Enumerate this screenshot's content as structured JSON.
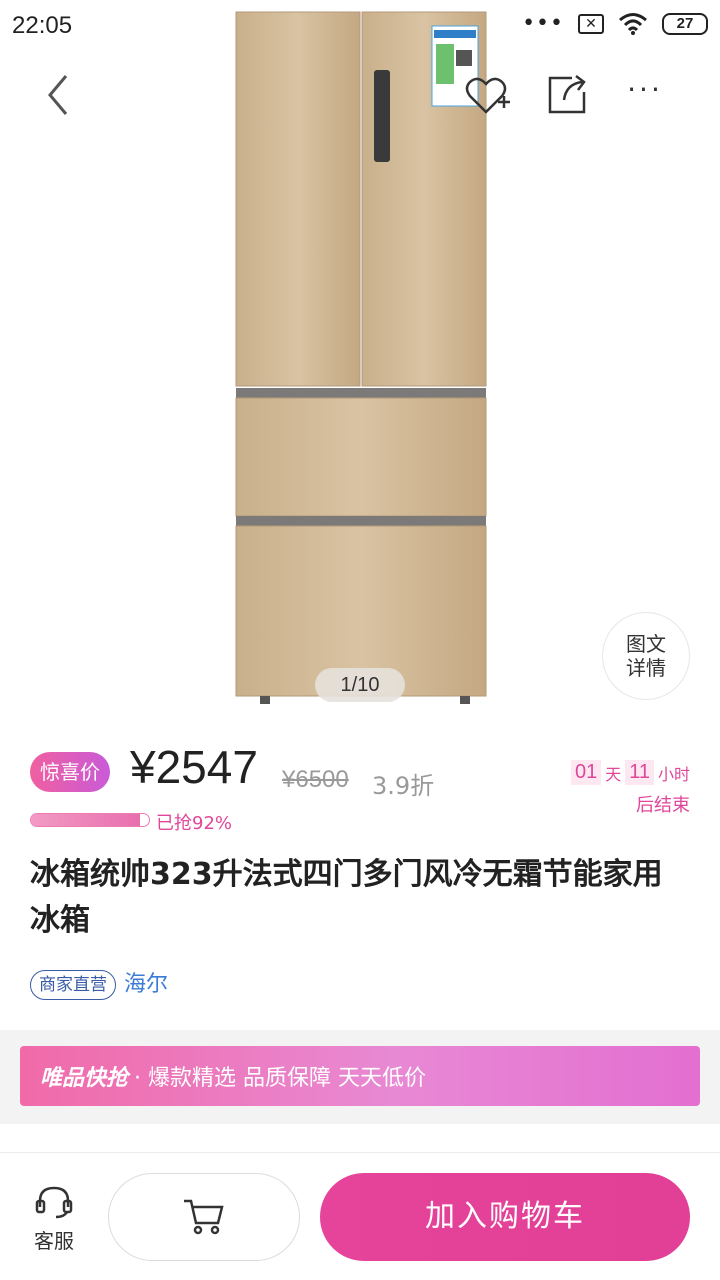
{
  "status_bar": {
    "time": "22:05",
    "battery": "27"
  },
  "image": {
    "counter": "1/10",
    "detail_button": [
      "图文",
      "详情"
    ]
  },
  "price": {
    "badge": "惊喜价",
    "current": "¥2547",
    "original": "¥6500",
    "discount": "3.9折"
  },
  "countdown": {
    "days": "01",
    "days_unit": "天",
    "hours": "11",
    "hours_unit": "小时",
    "suffix": "后结束"
  },
  "progress": {
    "fraction": 0.92,
    "label": "已抢92%"
  },
  "title": "冰箱统帅323升法式四门多门风冷无霜节能家用冰箱",
  "tags": {
    "self_operated": "商家直营",
    "brand": "海尔"
  },
  "promo": {
    "logo": "唯品快抢",
    "slogan": "· 爆款精选  品质保障  天天低价"
  },
  "bottom": {
    "service_label": "客服",
    "add_to_cart": "加入购物车"
  },
  "colors": {
    "accent": "#e23f96",
    "link": "#3a7bd5"
  },
  "icons": [
    "back-icon",
    "favorite-add-icon",
    "share-icon",
    "more-icon",
    "headset-icon",
    "cart-icon"
  ]
}
